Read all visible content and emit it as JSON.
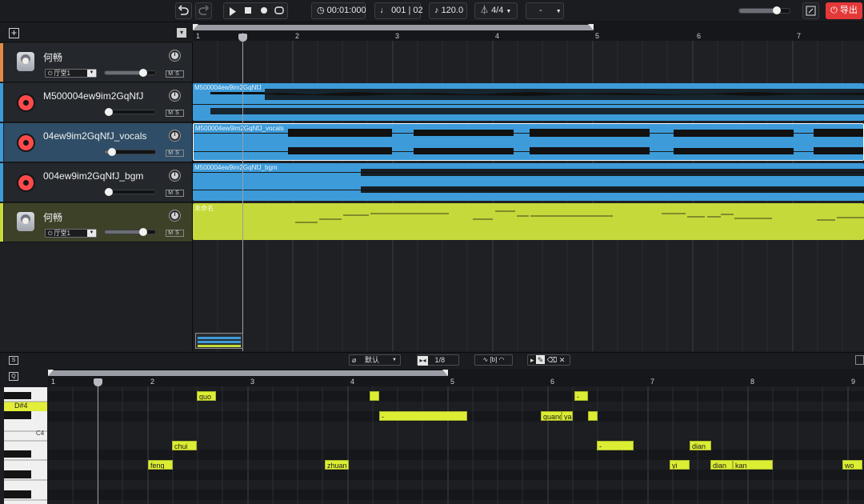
{
  "toolbar": {
    "undo_icon": "undo-icon",
    "redo_icon": "redo-icon",
    "time": "00:01:000",
    "bar_beat": "001 | 02",
    "tempo": "120.0",
    "signature": "4/4",
    "key": "-",
    "export_label": "导出"
  },
  "tracks": [
    {
      "name": "何畅",
      "type": "voice",
      "color": "#e58a44",
      "hall": "厅堂1",
      "volume": 0.75
    },
    {
      "name": "M500004ew9im2GqNfJ",
      "type": "audio",
      "color": "#3d9bd9",
      "volume": 0.05
    },
    {
      "name": "04ew9im2GqNfJ_vocals",
      "type": "audio",
      "color": "#3d9bd9",
      "volume": 0.1
    },
    {
      "name": "004ew9im2GqNfJ_bgm",
      "type": "audio",
      "color": "#3d9bd9",
      "volume": 0.05
    },
    {
      "name": "何畅",
      "type": "voice",
      "color": "#c6d93a",
      "hall": "厅堂1",
      "volume": 0.75
    }
  ],
  "clips": [
    {
      "label": "M500004ew9im2GqNfJ"
    },
    {
      "label": "M500004ew9im2GqNfJ_vocals"
    },
    {
      "label": "M500004ew9im2GqNfJ_bgm"
    },
    {
      "label": "未命名"
    }
  ],
  "ruler": [
    "1",
    "2",
    "3",
    "4",
    "5",
    "6",
    "7"
  ],
  "editor": {
    "quantize_label": "默认",
    "grid": "1/8",
    "roll_ruler": [
      "1",
      "2",
      "3",
      "4",
      "5",
      "6",
      "7",
      "8",
      "9"
    ],
    "piano_labels": {
      "d4sharp": "D#4",
      "c4": "C4"
    },
    "notes": [
      {
        "lyric": "guo"
      },
      {
        "lyric": ""
      },
      {
        "lyric": "-"
      },
      {
        "lyric": "-"
      },
      {
        "lyric": "guang"
      },
      {
        "lyric": "ya"
      },
      {
        "lyric": ""
      },
      {
        "lyric": "chui"
      },
      {
        "lyric": "-"
      },
      {
        "lyric": "dian"
      },
      {
        "lyric": "feng"
      },
      {
        "lyric": "zhuan"
      },
      {
        "lyric": "yi"
      },
      {
        "lyric": "dian"
      },
      {
        "lyric": "kan"
      },
      {
        "lyric": "wo"
      }
    ]
  }
}
